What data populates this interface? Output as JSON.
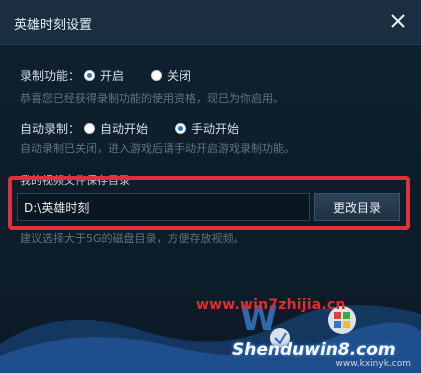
{
  "window": {
    "title": "英雄时刻设置"
  },
  "record_feature": {
    "label": "录制功能：",
    "options": [
      {
        "label": "开启",
        "selected": true
      },
      {
        "label": "关闭",
        "selected": false
      }
    ],
    "hint": "恭喜您已经获得录制功能的使用资格，现已为你启用。"
  },
  "auto_record": {
    "label": "自动录制：",
    "options": [
      {
        "label": "自动开始",
        "selected": false
      },
      {
        "label": "手动开始",
        "selected": true
      }
    ],
    "hint": "自动录制已关闭，进入游戏后请手动开启游戏录制功能。"
  },
  "save_dir": {
    "label": "我的视频文件保存目录",
    "value": "D:\\英雄时刻",
    "button_label": "更改目录",
    "hint": "建议选择大于5G的磁盘目录，方便存放视频。"
  },
  "watermark": {
    "url": "www.win7zhijia.cn",
    "brand": "Shenduwin8.com",
    "small_url": "www.kxinyk.com"
  },
  "colors": {
    "background": "#0f1f2c",
    "titlebar": "#1a2e40",
    "accent": "#1a7ad4",
    "highlight": "#e0303a",
    "hint_text": "#5d7486"
  }
}
